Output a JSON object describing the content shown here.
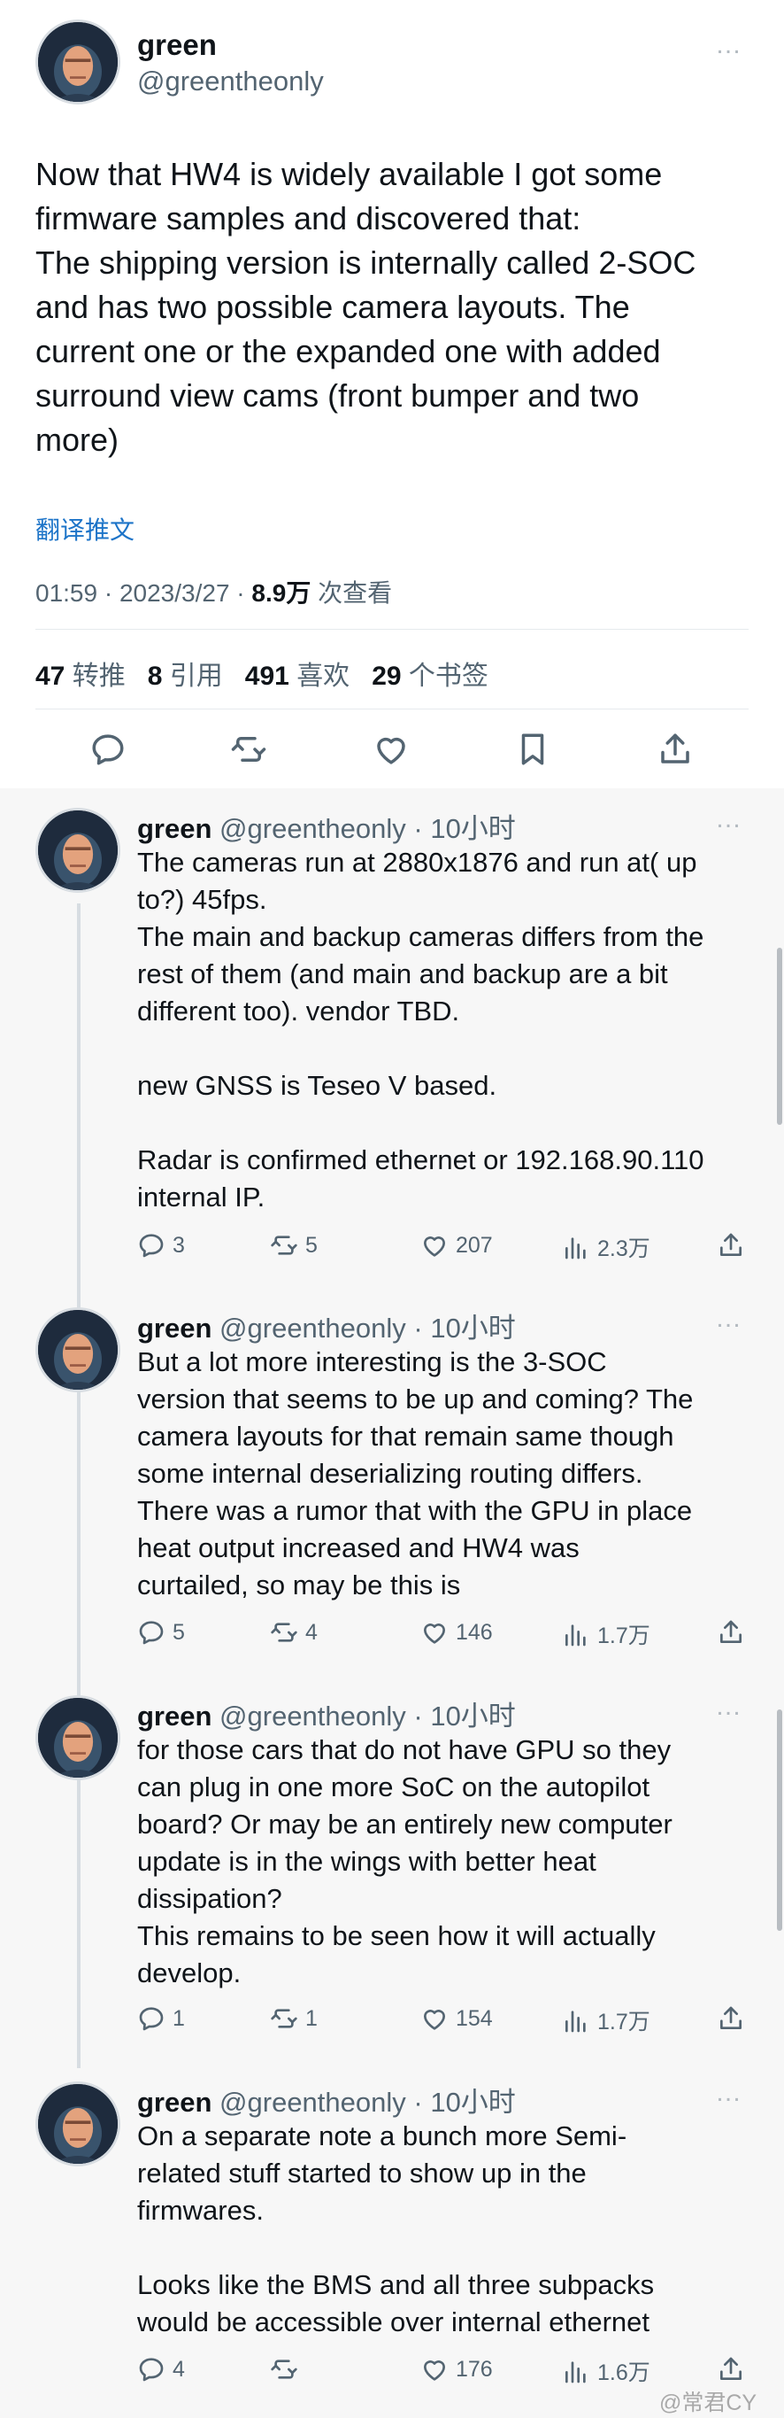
{
  "main_tweet": {
    "author_name": "green",
    "author_handle": "@greentheonly",
    "more_icon": "…",
    "text": "Now that HW4 is widely available I got some\nfirmware samples and discovered that:\nThe shipping version is internally called 2-SOC\nand has two possible camera layouts. The\ncurrent one or the expanded one with added\nsurround view cams (front bumper and two\nmore)",
    "translate_label": "翻译推文",
    "time": "01:59 · 2023/3/27 ·",
    "views_count": "8.9万",
    "views_label": "次查看",
    "retweets_count": "47",
    "retweets_label": "转推",
    "quotes_count": "8",
    "quotes_label": "引用",
    "likes_count": "491",
    "likes_label": "喜欢",
    "bookmarks_count": "29",
    "bookmarks_label": "个书签",
    "actions": [
      "reply-icon",
      "retweet-icon",
      "like-icon",
      "bookmark-icon",
      "share-icon"
    ]
  },
  "replies": [
    {
      "name": "green",
      "handle": "@greentheonly",
      "time": "· 10小时",
      "text": "The cameras run at 2880x1876 and run at( up\nto?) 45fps.\nThe main and backup cameras differs from the\nrest of them (and main and backup are a bit\ndifferent too). vendor TBD.\n\nnew GNSS is Teseo V based.\n\nRadar is confirmed ethernet or 192.168.90.110\ninternal IP.",
      "replies": "3",
      "retweets": "5",
      "likes": "207",
      "views": "2.3万"
    },
    {
      "name": "green",
      "handle": "@greentheonly",
      "time": "· 10小时",
      "text": "But a lot more interesting is the 3-SOC\nversion that seems to be up and coming? The\ncamera layouts for that remain same though\nsome internal deserializing routing differs.\nThere was a rumor that with the GPU in place\nheat output increased and HW4 was\ncurtailed, so may be this is",
      "replies": "5",
      "retweets": "4",
      "likes": "146",
      "views": "1.7万"
    },
    {
      "name": "green",
      "handle": "@greentheonly",
      "time": "· 10小时",
      "text": "for those cars that do not have GPU so they\ncan plug in one more SoC on the autopilot\nboard? Or may be an entirely new computer\nupdate is in the wings with better heat\ndissipation?\nThis remains to be seen how it will actually\ndevelop.",
      "replies": "1",
      "retweets": "1",
      "likes": "154",
      "views": "1.7万"
    },
    {
      "name": "green",
      "handle": "@greentheonly",
      "time": "· 10小时",
      "text": "On a separate note a bunch more Semi-\nrelated stuff started to show up in the\nfirmwares.\n\nLooks like the BMS and all three subpacks\nwould be accessible over internal ethernet",
      "replies": "4",
      "retweets": "",
      "likes": "176",
      "views": "1.6万"
    }
  ],
  "watermark": "@常君CY",
  "colors": {
    "text": "#0f1419",
    "secondary": "#536471",
    "link": "#1d74c8",
    "reply_background": "#f7f7f7",
    "thread_line": "#d7dde2"
  }
}
